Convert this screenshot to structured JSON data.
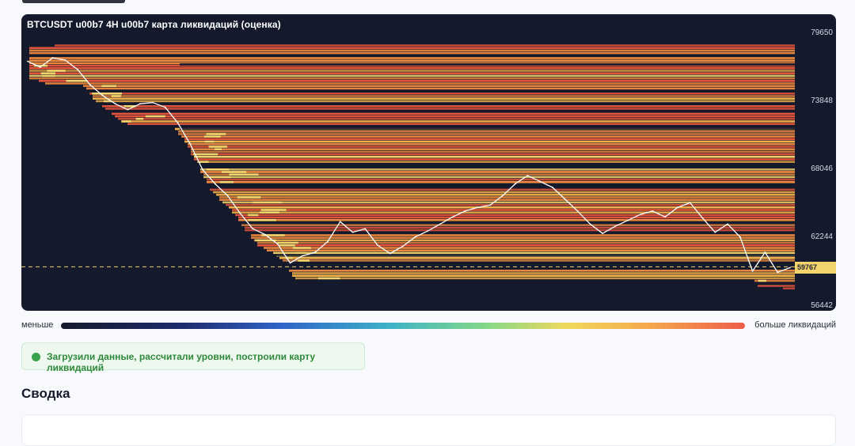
{
  "chart": {
    "title": "BTCUSDT u00b7 4H u00b7 карта ликвидаций (оценка)",
    "price_ticks": [
      "79650",
      "73848",
      "68046",
      "62244",
      "56442"
    ],
    "current_price": "59767",
    "colors": {
      "background": "#141a2b",
      "low": "#e9563b",
      "mid": "#f08a3f",
      "high": "#f5b24a",
      "peak": "#f3d36b",
      "price_line": "#ffffff",
      "marker": "#f3d36b"
    }
  },
  "legend": {
    "min_label": "меньше",
    "max_label": "больше ликвидаций"
  },
  "status": {
    "text": "Загрузили данные, рассчитали уровни, построили карту ликвидаций",
    "color": "#3aa24a"
  },
  "summary": {
    "title": "Сводка"
  },
  "chart_data": {
    "type": "heatmap",
    "title": "BTCUSDT u00b7 4H u00b7 карта ликвидаций (оценка)",
    "y_ticks": [
      79650,
      73848,
      68046,
      62244,
      56442
    ],
    "ylim": [
      56442,
      79650
    ],
    "current_price": 59767,
    "price_series": [
      77200,
      76700,
      77500,
      77300,
      76500,
      75200,
      74300,
      73600,
      73100,
      73600,
      73700,
      73300,
      72000,
      70200,
      68000,
      66800,
      65800,
      64300,
      63000,
      62500,
      61700,
      60100,
      60700,
      61000,
      61900,
      63600,
      62700,
      63000,
      61600,
      60900,
      61500,
      62300,
      62800,
      63400,
      64000,
      64500,
      64800,
      65000,
      65800,
      66800,
      67500,
      67000,
      66500,
      65500,
      64500,
      63400,
      62600,
      63200,
      63700,
      64200,
      64500,
      64000,
      64800,
      65200,
      63900,
      62700,
      63400,
      62300,
      59400,
      61000,
      59300,
      59700
    ],
    "legend": [
      "меньше",
      "больше ликвидаций"
    ]
  }
}
